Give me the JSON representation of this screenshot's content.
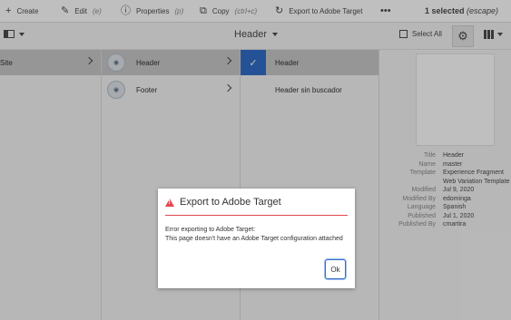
{
  "actionbar": {
    "create": {
      "label": "Create"
    },
    "edit": {
      "label": "Edit",
      "shortcut": "(e)"
    },
    "properties": {
      "label": "Properties",
      "shortcut": "(p)"
    },
    "copy": {
      "label": "Copy",
      "shortcut": "(ctrl+c)"
    },
    "export": {
      "label": "Export to Adobe Target"
    },
    "more_icon": "more-icon",
    "selection": {
      "count": "1 selected",
      "hint": "(escape)"
    }
  },
  "toolbar": {
    "title": "Header",
    "select_all": "Select All"
  },
  "columns": {
    "col1": [
      {
        "label": "Site"
      }
    ],
    "col2": [
      {
        "label": "Header"
      },
      {
        "label": "Footer"
      }
    ],
    "col3": [
      {
        "label": "Header"
      },
      {
        "label": "Header sin buscador"
      }
    ]
  },
  "meta": [
    {
      "label": "Title",
      "value": "Header"
    },
    {
      "label": "Name",
      "value": "master"
    },
    {
      "label": "Template",
      "value": "Experience Fragment Web Variation Template"
    },
    {
      "label": "Modified",
      "value": "Jul 9, 2020"
    },
    {
      "label": "Modified By",
      "value": "edominga"
    },
    {
      "label": "Language",
      "value": "Spanish"
    },
    {
      "label": "Published",
      "value": "Jul 1, 2020"
    },
    {
      "label": "Published By",
      "value": "cmartira"
    }
  ],
  "dialog": {
    "title": "Export to Adobe Target",
    "line1": "Error exporting to Adobe Target:",
    "line2": "This page doesn't have an Adobe Target configuration attached",
    "ok": "Ok"
  },
  "colors": {
    "accent": "#326ec8",
    "error": "#e34850"
  }
}
